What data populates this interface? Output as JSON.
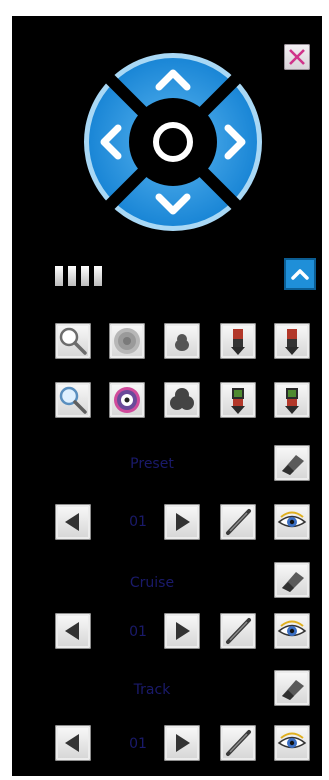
{
  "window": {
    "close_icon": "close-x-icon",
    "accent_color": "#1e90ff"
  },
  "ptz": {
    "up_icon": "chevron-up-icon",
    "down_icon": "chevron-down-icon",
    "left_icon": "chevron-left-icon",
    "right_icon": "chevron-right-icon",
    "center_icon": "ring-icon",
    "speed_level_segments": 4,
    "collapse_icon": "chevron-up-icon"
  },
  "toolbar_rows": [
    [
      "zoom-out-icon",
      "focus-out-icon",
      "iris-close-icon",
      "preset-down-icon",
      "preset-down-icon"
    ],
    [
      "zoom-in-icon",
      "focus-in-icon",
      "iris-open-icon",
      "preset-up-icon",
      "preset-up-icon"
    ]
  ],
  "sections": [
    {
      "label": "Preset",
      "value": "01"
    },
    {
      "label": "Cruise",
      "value": "01"
    },
    {
      "label": "Track",
      "value": "01"
    }
  ]
}
